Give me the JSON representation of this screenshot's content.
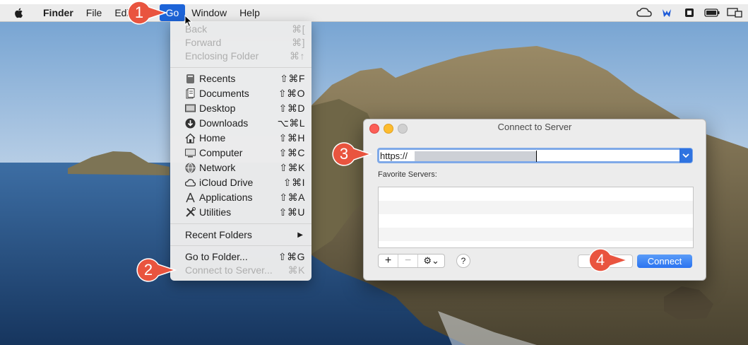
{
  "menubar": {
    "app_name": "Finder",
    "items": [
      "File",
      "Edi",
      "Go",
      "Window",
      "Help"
    ],
    "active": "Go",
    "status_icons": [
      "creative-cloud-icon",
      "malwarebytes-icon",
      "bitdefender-icon",
      "battery-icon",
      "display-icon"
    ]
  },
  "go_menu": {
    "group1": [
      {
        "label": "Back",
        "shortcut": "⌘[",
        "disabled": true
      },
      {
        "label": "Forward",
        "shortcut": "⌘]",
        "disabled": true
      },
      {
        "label": "Enclosing Folder",
        "shortcut": "⌘↑",
        "disabled": true
      }
    ],
    "group2": [
      {
        "label": "Recents",
        "shortcut": "⇧⌘F",
        "icon": "recents-icon"
      },
      {
        "label": "Documents",
        "shortcut": "⇧⌘O",
        "icon": "documents-icon"
      },
      {
        "label": "Desktop",
        "shortcut": "⇧⌘D",
        "icon": "desktop-icon"
      },
      {
        "label": "Downloads",
        "shortcut": "⌥⌘L",
        "icon": "downloads-icon"
      },
      {
        "label": "Home",
        "shortcut": "⇧⌘H",
        "icon": "home-icon"
      },
      {
        "label": "Computer",
        "shortcut": "⇧⌘C",
        "icon": "computer-icon"
      },
      {
        "label": "Network",
        "shortcut": "⇧⌘K",
        "icon": "network-icon"
      },
      {
        "label": "iCloud Drive",
        "shortcut": "⇧⌘I",
        "icon": "icloud-icon"
      },
      {
        "label": "Applications",
        "shortcut": "⇧⌘A",
        "icon": "applications-icon"
      },
      {
        "label": "Utilities",
        "shortcut": "⇧⌘U",
        "icon": "utilities-icon"
      }
    ],
    "recent_folders": "Recent Folders",
    "group3": [
      {
        "label": "Go to Folder...",
        "shortcut": "⇧⌘G",
        "disabled": false
      },
      {
        "label": "Connect to Server...",
        "shortcut": "⌘K",
        "disabled": true
      }
    ]
  },
  "dialog": {
    "title": "Connect to Server",
    "url_value": "https://",
    "favorites_label": "Favorite Servers:",
    "add_label": "+",
    "remove_label": "−",
    "gear_label": "⚙︎⌄",
    "help_label": "?",
    "connect_label": "Connect"
  },
  "callouts": [
    "1",
    "2",
    "3",
    "4"
  ],
  "colors": {
    "accent": "#1d64d8",
    "callout": "#e9543f"
  }
}
